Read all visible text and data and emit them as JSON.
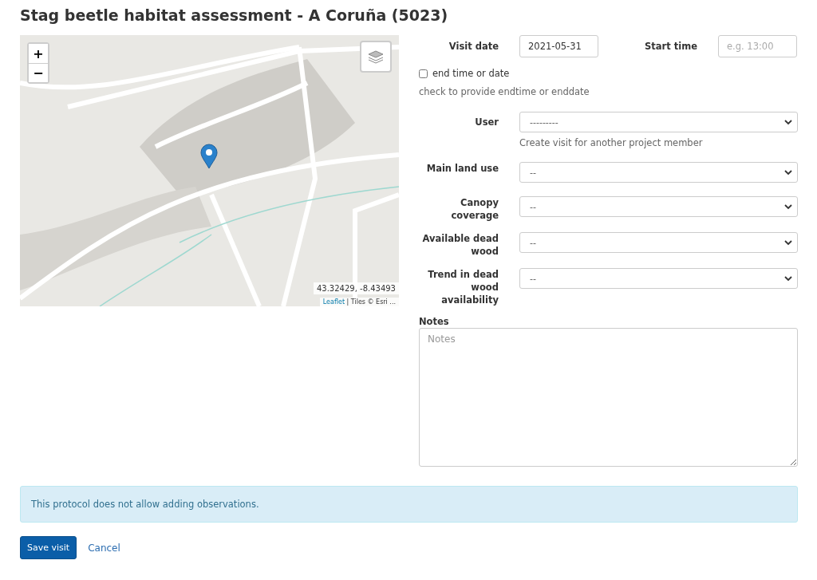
{
  "page_title": "Stag beetle habitat assessment - A Coruña (5023)",
  "map": {
    "zoom_in": "+",
    "zoom_out": "−",
    "coordinates": "43.32429, -8.43493",
    "attribution_link": "Leaflet",
    "attribution_text": "| Tiles © Esri ..."
  },
  "visit_date": {
    "label": "Visit date",
    "value": "2021-05-31"
  },
  "start_time": {
    "label": "Start time",
    "placeholder": "e.g. 13:00"
  },
  "end_toggle": {
    "label": "end time or date",
    "checked": false,
    "help": "check to provide endtime or enddate"
  },
  "user": {
    "label": "User",
    "value": "---------",
    "help": "Create visit for another project member"
  },
  "selects": [
    {
      "label": "Main land use",
      "value": "--"
    },
    {
      "label": "Canopy coverage",
      "value": "--"
    },
    {
      "label": "Available dead wood",
      "value": "--"
    },
    {
      "label": "Trend in dead wood availability",
      "value": "--"
    }
  ],
  "notes": {
    "label": "Notes",
    "placeholder": "Notes"
  },
  "alert": "This protocol does not allow adding observations.",
  "buttons": {
    "save": "Save visit",
    "cancel": "Cancel"
  }
}
